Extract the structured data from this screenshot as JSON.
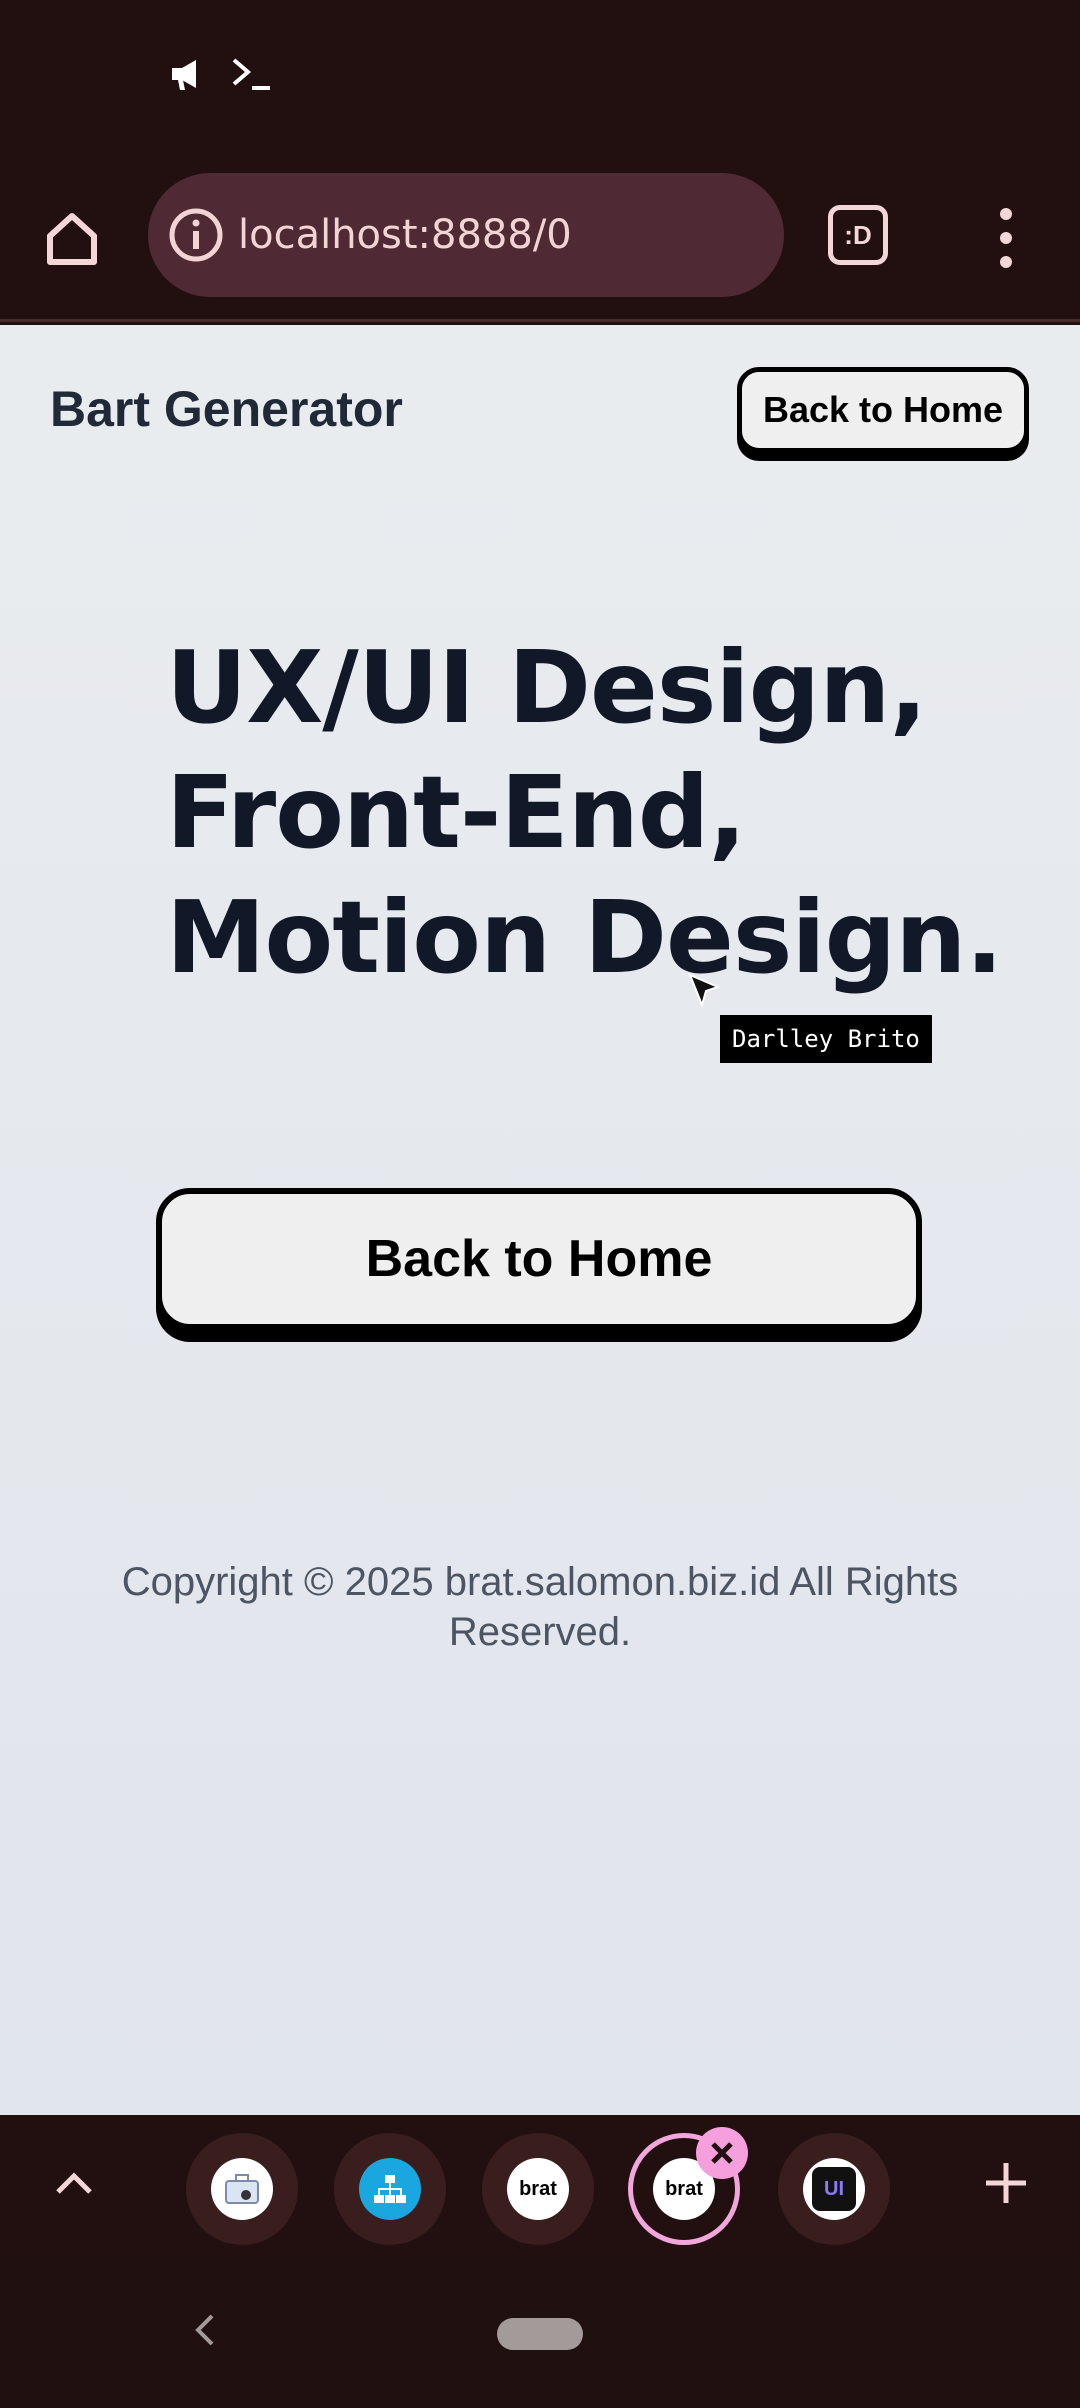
{
  "status_bar": {
    "icons": [
      "megaphone-icon",
      "terminal-icon"
    ]
  },
  "browser": {
    "url": "localhost:8888/0",
    "tab_switcher_label": ":D"
  },
  "page": {
    "brand": "Bart Generator",
    "top_button": "Back to Home",
    "hero_lines": [
      "UX/UI Design,",
      "Front-End,",
      "Motion Design."
    ],
    "tooltip": "Darlley Brito",
    "main_button": "Back to Home",
    "copyright": "Copyright © 2025 brat.salomon.biz.id All Rights Reserved."
  },
  "tabs": [
    {
      "name": "tab-toolbox",
      "label": ""
    },
    {
      "name": "tab-sitemap",
      "label": ""
    },
    {
      "name": "tab-brat",
      "label": "brat"
    },
    {
      "name": "tab-brat-active",
      "label": "brat"
    },
    {
      "name": "tab-ui",
      "label": "UI"
    }
  ],
  "colors": {
    "chrome_bg": "#221010",
    "url_bar": "#4f2a35",
    "accent_pink": "#f2a6dc",
    "page_bg": "#e9ecef"
  }
}
